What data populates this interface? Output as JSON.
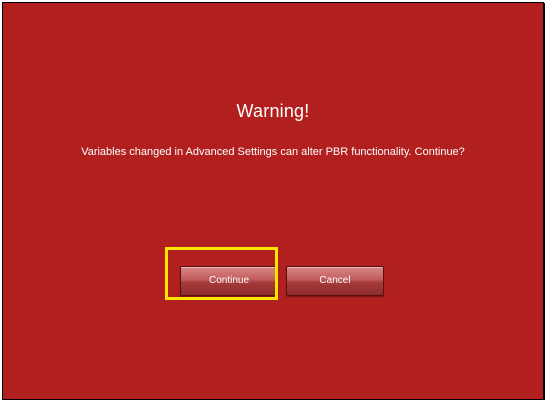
{
  "dialog": {
    "title": "Warning!",
    "message": "Variables changed in Advanced Settings can alter PBR functionality. Continue?",
    "background_color": "#b21f1f"
  },
  "buttons": {
    "continue_label": "Continue",
    "cancel_label": "Cancel"
  },
  "highlight": {
    "target": "continue-button",
    "color": "#ffe600"
  }
}
